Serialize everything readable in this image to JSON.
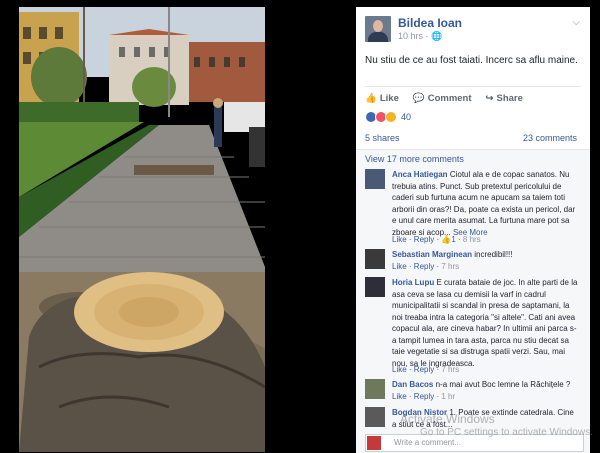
{
  "post": {
    "author": "Bildea Ioan",
    "time": "10 hrs",
    "privacy_icon": "globe-icon",
    "text": "Nu stiu de ce au fost taiati. Incerc sa aflu maine.",
    "actions": {
      "like": "Like",
      "comment": "Comment",
      "share": "Share"
    },
    "reactions_count": "40",
    "shares": "5 shares",
    "comments_count": "23 comments",
    "view_more": "View 17 more comments"
  },
  "comments": [
    {
      "name": "Anca Hatiegan",
      "text": "Ciotul ala e de copac sanatos. Nu trebuia atins. Punct. Sub pretextul pericolului de caderi sub furtuna acum ne apucam sa taiem toti arborii din oras?! Da, poate ca exista un pericol, dar e unul care merita asumat. La furtuna mare pot sa zboare si acop...",
      "see_more": "See More",
      "like": "Like",
      "reply": "Reply",
      "likes": "1",
      "time": "8 hrs"
    },
    {
      "name": "Sebastian Marginean",
      "text": "incredibil!!!",
      "like": "Like",
      "reply": "Reply",
      "time": "7 hrs"
    },
    {
      "name": "Horia Lupu",
      "text": "E curata bataie de joc. In alte parti de la asa ceva se lasa cu demisii la varf in cadrul municipalitatii si scandal in presa de saptamani, la noi treaba intra la categoria \"si altele\". Cati ani avea copacul ala, are cineva habar? In ultimii ani parca s-a tampit lumea in tara asta, parca nu stiu decat sa taie vegetatie si sa distruga spatii verzi. Sau, mai nou, sa le ingradeasca.",
      "like": "Like",
      "reply": "Reply",
      "time": "7 hrs"
    },
    {
      "name": "Dan Bacos",
      "text": "n-a mai avut Boc lemne la Răchițele ?",
      "like": "Like",
      "reply": "Reply",
      "time": "1 hr"
    },
    {
      "name": "Bogdan Nistor",
      "text": "1. Poate se extinde catedrala. Cine a stiut ce a fost..."
    }
  ],
  "write_placeholder": "Write a comment...",
  "watermark": {
    "line1": "Activate Windows",
    "line2": "Go to PC settings to activate Windows."
  }
}
